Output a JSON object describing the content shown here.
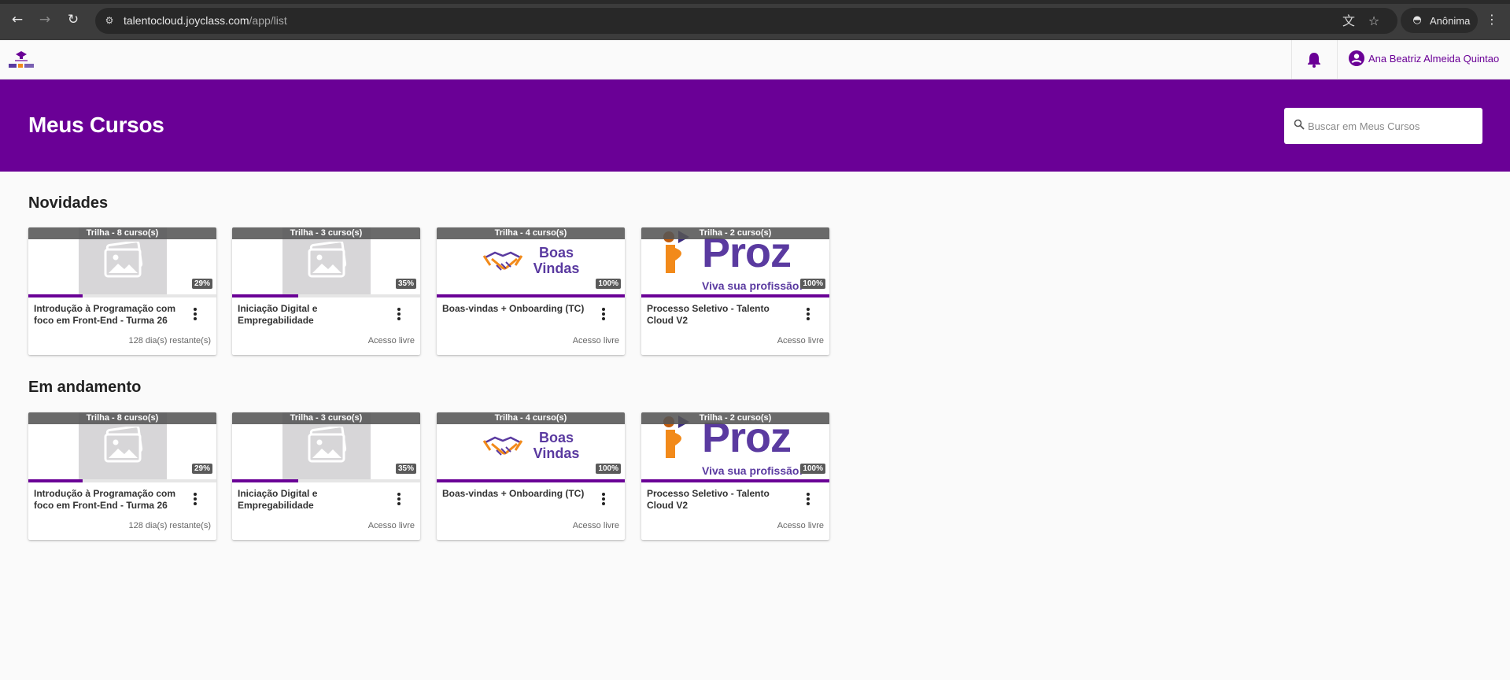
{
  "browser": {
    "url_host": "talentocloud.joyclass.com",
    "url_path": "/app/list",
    "profile_label": "Anônima"
  },
  "header": {
    "user_name": "Ana Beatriz Almeida Quintao"
  },
  "banner": {
    "title": "Meus Cursos",
    "search_placeholder": "Buscar em Meus Cursos"
  },
  "colors": {
    "brand_purple": "#6a0096",
    "proz_purple": "#5a3aa0",
    "proz_orange": "#f28a1a"
  },
  "sections": [
    {
      "title": "Novidades",
      "cards": [
        {
          "trail": "Trilha - 8 curso(s)",
          "thumb": "placeholder",
          "progress": 0.29,
          "percent_label": "29%",
          "title": "Introdução à Programação com foco em Front-End - Turma 26",
          "footer": "128 dia(s) restante(s)"
        },
        {
          "trail": "Trilha - 3 curso(s)",
          "thumb": "placeholder",
          "progress": 0.35,
          "percent_label": "35%",
          "title": "Iniciação Digital e Empregabilidade",
          "footer": "Acesso livre"
        },
        {
          "trail": "Trilha - 4 curso(s)",
          "thumb": "boas-vindas",
          "thumb_text": [
            "Boas",
            "Vindas"
          ],
          "progress": 1.0,
          "percent_label": "100%",
          "title": "Boas-vindas + Onboarding (TC)",
          "footer": "Acesso livre"
        },
        {
          "trail": "Trilha - 2 curso(s)",
          "thumb": "proz",
          "thumb_text": [
            "Proz",
            "Viva sua profissão!"
          ],
          "progress": 1.0,
          "percent_label": "100%",
          "title": "Processo Seletivo - Talento Cloud V2",
          "footer": "Acesso livre"
        }
      ]
    },
    {
      "title": "Em andamento",
      "cards": [
        {
          "trail": "Trilha - 8 curso(s)",
          "thumb": "placeholder",
          "progress": 0.29,
          "percent_label": "29%",
          "title": "Introdução à Programação com foco em Front-End - Turma 26",
          "footer": "128 dia(s) restante(s)"
        },
        {
          "trail": "Trilha - 3 curso(s)",
          "thumb": "placeholder",
          "progress": 0.35,
          "percent_label": "35%",
          "title": "Iniciação Digital e Empregabilidade",
          "footer": "Acesso livre"
        },
        {
          "trail": "Trilha - 4 curso(s)",
          "thumb": "boas-vindas",
          "thumb_text": [
            "Boas",
            "Vindas"
          ],
          "progress": 1.0,
          "percent_label": "100%",
          "title": "Boas-vindas + Onboarding (TC)",
          "footer": "Acesso livre"
        },
        {
          "trail": "Trilha - 2 curso(s)",
          "thumb": "proz",
          "thumb_text": [
            "Proz",
            "Viva sua profissão!"
          ],
          "progress": 1.0,
          "percent_label": "100%",
          "title": "Processo Seletivo - Talento Cloud V2",
          "footer": "Acesso livre"
        }
      ]
    }
  ]
}
